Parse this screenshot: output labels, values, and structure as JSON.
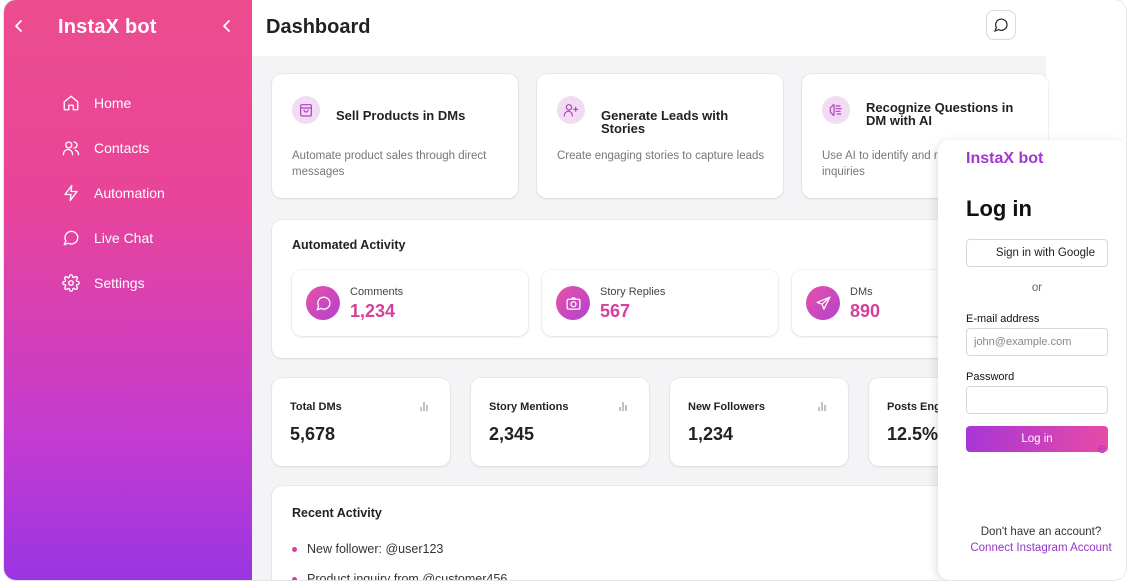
{
  "app": {
    "brand": "InstaX bot"
  },
  "sidebar": {
    "items": [
      {
        "label": "Home",
        "icon": "home-icon"
      },
      {
        "label": "Contacts",
        "icon": "users-icon"
      },
      {
        "label": "Automation",
        "icon": "lightning-icon"
      },
      {
        "label": "Live Chat",
        "icon": "chat-icon"
      },
      {
        "label": "Settings",
        "icon": "gear-icon"
      }
    ]
  },
  "header": {
    "title": "Dashboard"
  },
  "features": [
    {
      "title": "Sell Products in DMs",
      "desc": "Automate product sales through direct messages",
      "icon": "shopping-bag-icon"
    },
    {
      "title": "Generate Leads with Stories",
      "desc": "Create engaging stories to capture leads",
      "icon": "user-plus-icon"
    },
    {
      "title": "Recognize Questions in DM with AI",
      "desc": "Use AI to identify and r",
      "desc2": "inquiries",
      "icon": "brain-icon"
    }
  ],
  "automated": {
    "title": "Automated Activity",
    "items": [
      {
        "label": "Comments",
        "value": "1,234",
        "icon": "comment-icon"
      },
      {
        "label": "Story Replies",
        "value": "567",
        "icon": "camera-icon"
      },
      {
        "label": "DMs",
        "value": "890",
        "icon": "send-icon"
      }
    ]
  },
  "stats": [
    {
      "label": "Total DMs",
      "value": "5,678"
    },
    {
      "label": "Story Mentions",
      "value": "2,345"
    },
    {
      "label": "New Followers",
      "value": "1,234"
    },
    {
      "label": "Posts Enga",
      "value": "12.5%"
    }
  ],
  "recent": {
    "title": "Recent Activity",
    "items": [
      "New follower: @user123",
      "Product inquiry from @customer456"
    ]
  },
  "login": {
    "brand": "InstaX bot",
    "title": "Log in",
    "google": "Sign in with Google",
    "or": "or",
    "email_label": "E-mail address",
    "email_placeholder": "john@example.com",
    "password_label": "Password",
    "button": "Log in",
    "button_tail": "e",
    "no_account": "Don't have an account?",
    "connect": "Connect Instagram Account"
  },
  "colors": {
    "accent": "#d6409a",
    "brand_purple": "#a236d0"
  }
}
